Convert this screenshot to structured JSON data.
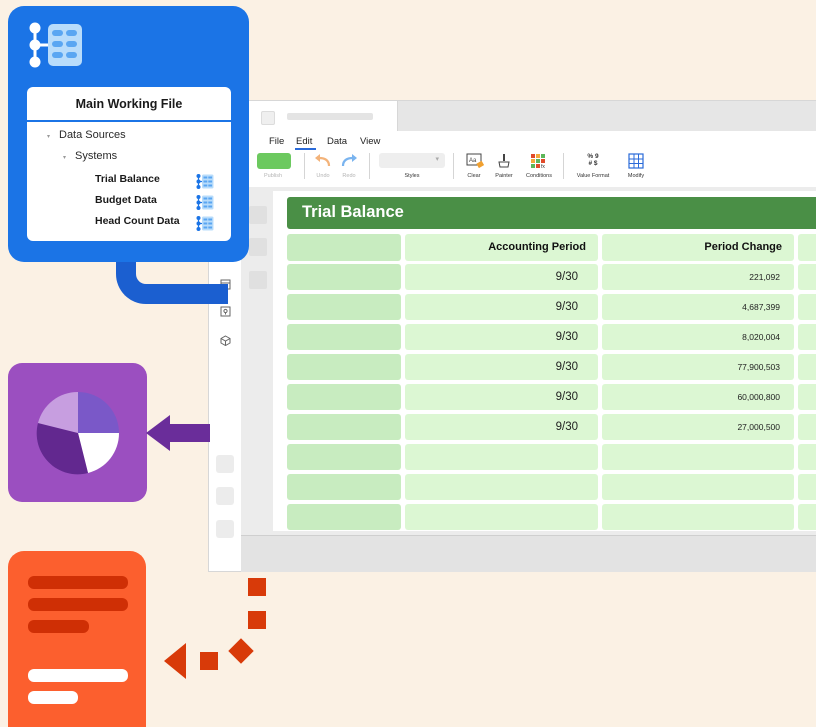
{
  "app": {
    "menu": [
      "File",
      "Edit",
      "Data",
      "View"
    ],
    "active_menu": "Edit",
    "ribbon": {
      "publish": "Publish",
      "undo": "Undo",
      "redo": "Redo",
      "styles": "Styles",
      "clear": "Clear",
      "painter": "Painter",
      "conditions": "Conditions",
      "value_format": "Value Format",
      "value_format_glyphs": "% 9\n# $",
      "modify": "Modify"
    },
    "sheet": {
      "title": "Trial Balance",
      "columns": [
        "",
        "Accounting Period",
        "Period Change",
        ""
      ],
      "rows": [
        {
          "period": "9/30",
          "change": "221,092"
        },
        {
          "period": "9/30",
          "change": "4,687,399"
        },
        {
          "period": "9/30",
          "change": "8,020,004"
        },
        {
          "period": "9/30",
          "change": "77,900,503"
        },
        {
          "period": "9/30",
          "change": "60,000,800"
        },
        {
          "period": "9/30",
          "change": "27,000,500"
        },
        {
          "period": "",
          "change": ""
        },
        {
          "period": "",
          "change": ""
        },
        {
          "period": "",
          "change": ""
        }
      ]
    }
  },
  "data_source_panel": {
    "title": "Main Working File",
    "tree": {
      "root": "Data Sources",
      "group": "Systems",
      "items": [
        "Trial Balance",
        "Budget Data",
        "Head Count Data"
      ]
    }
  },
  "colors": {
    "panel": "#1b74e6",
    "title_bar": "#4a8f46",
    "pie_tile": "#9b4fc0",
    "doc_tile": "#fc5f2e",
    "connector": "#1b5fd0",
    "arrow_purple": "#6a2d9a",
    "dash_orange": "#d83a09"
  },
  "icons": [
    "tree-structure-icon",
    "undo-icon",
    "redo-icon",
    "clear-icon",
    "painter-icon",
    "conditions-icon",
    "value-format-icon",
    "modify-icon",
    "pie-chart-icon",
    "document-icon"
  ]
}
